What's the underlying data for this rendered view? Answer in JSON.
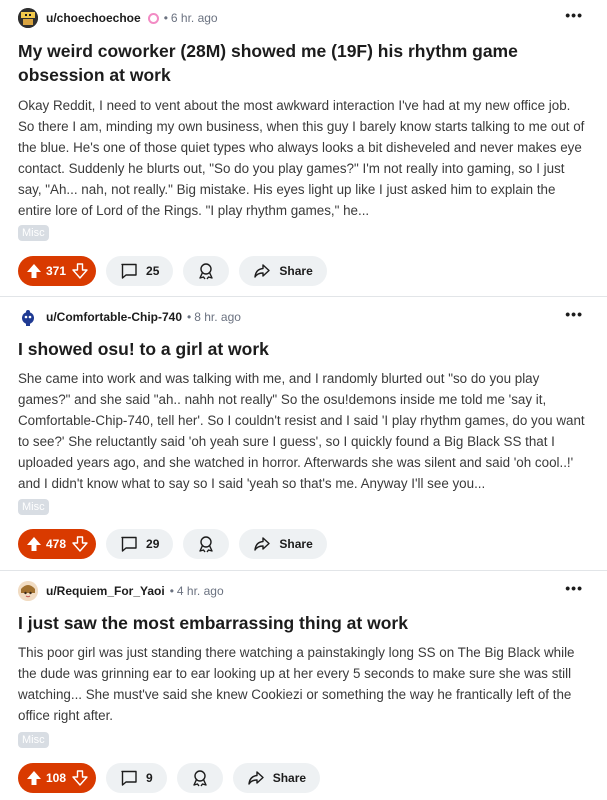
{
  "posts": [
    {
      "author": "u/choechoechoe",
      "time": "6 hr. ago",
      "title": "My weird coworker (28M) showed me (19F) his rhythm game obsession at work",
      "body": "Okay Reddit, I need to vent about the most awkward interaction I've had at my new office job. So there I am, minding my own business, when this guy I barely know starts talking to me out of the blue. He's one of those quiet types who always looks a bit disheveled and never makes eye contact. Suddenly he blurts out, \"So do you play games?\" I'm not really into gaming, so I just say, \"Ah... nah, not really.\" Big mistake. His eyes light up like I just asked him to explain the entire lore of Lord of the Rings. \"I play rhythm games,\" he...",
      "flair": "Misc",
      "votes": "371",
      "comments": "25",
      "share_label": "Share"
    },
    {
      "author": "u/Comfortable-Chip-740",
      "time": "8 hr. ago",
      "title": "I showed osu! to a girl at work",
      "body": "She came into work and was talking with me, and I randomly blurted out \"so do you play games?\" and she said \"ah.. nahh not really\" So the osu!demons inside me told me 'say it, Comfortable-Chip-740, tell her'. So I couldn't resist and I said 'I play rhythm games, do you want to see?' She reluctantly said 'oh yeah sure I guess', so I quickly found a Big Black SS that I uploaded years ago, and she watched in horror. Afterwards she was silent and said 'oh cool..!' and I didn't know what to say so I said 'yeah so that's me. Anyway I'll see you...",
      "flair": "Misc",
      "votes": "478",
      "comments": "29",
      "share_label": "Share"
    },
    {
      "author": "u/Requiem_For_Yaoi",
      "time": "4 hr. ago",
      "title": "I just saw the most embarrassing thing at work",
      "body": "This poor girl was just standing there watching a painstakingly long SS on The Big Black while the dude was grinning ear to ear looking up at her every 5 seconds to make sure she was still watching... She must've said she knew Cookiezi or something the way he frantically left of the office right after.",
      "flair": "Misc",
      "votes": "108",
      "comments": "9",
      "share_label": "Share"
    }
  ],
  "separator": "•",
  "menu_glyph": "•••",
  "colors": {
    "upvote_active": "#d93a00",
    "pill_bg": "#eef1f3",
    "flair_bg": "#d8dde3",
    "divider": "#e2e5e8"
  },
  "icons": {
    "upvote": "upvote-arrow-icon",
    "downvote": "downvote-arrow-icon",
    "comment": "comment-bubble-icon",
    "award": "award-ribbon-icon",
    "share": "share-arrow-icon",
    "menu": "more-options-icon"
  }
}
